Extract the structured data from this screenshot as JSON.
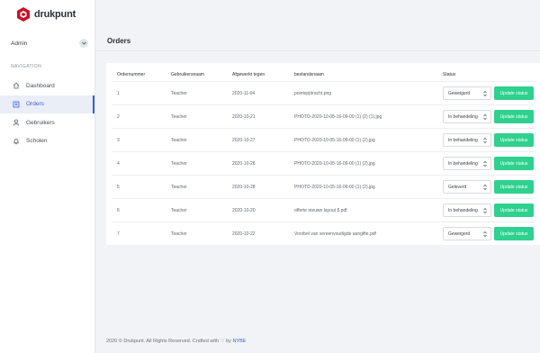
{
  "brand": {
    "name": "drukpunt",
    "color": "#c8102e"
  },
  "user": {
    "name": "Admin"
  },
  "nav": {
    "heading": "NAVIGATION",
    "items": [
      {
        "label": "Dashboard",
        "icon": "home-icon"
      },
      {
        "label": "Orders",
        "icon": "list-icon",
        "active": true
      },
      {
        "label": "Gebruikers",
        "icon": "user-icon"
      },
      {
        "label": "Scholen",
        "icon": "bell-icon"
      }
    ]
  },
  "page": {
    "title": "Orders"
  },
  "table": {
    "columns": [
      "Ordernummer",
      "Gebruikersnaam",
      "Afgewerkt tegen",
      "bestandsnaam",
      "Status"
    ],
    "rows": [
      {
        "id": "1",
        "user": "Teacher",
        "date": "2020-11-04",
        "file": "pointsp|dracht.png",
        "status": "Geweigerd"
      },
      {
        "id": "2",
        "user": "Teacher",
        "date": "2020-10-21",
        "file": "PHOTO-2020-10-05-16-09-00 (1) (2) (1).jpg",
        "status": "In behandeling"
      },
      {
        "id": "3",
        "user": "Teacher",
        "date": "2020-10-27",
        "file": "PHOTO-2020-10-05-16-09-00 (1) (2).jpg",
        "status": "In behandeling"
      },
      {
        "id": "4",
        "user": "Teacher",
        "date": "2020-10-28",
        "file": "PHOTO-2020-10-05-16-09-00 (1) (2).jpg",
        "status": "In behandeling"
      },
      {
        "id": "5",
        "user": "Teacher",
        "date": "2020-10-28",
        "file": "PHOTO-2020-10-05-16-09-00 (1) (2).jpg",
        "status": "Geleverd"
      },
      {
        "id": "6",
        "user": "Teacher",
        "date": "2020-10-20",
        "file": "offerte nieuwe layout 8.pdf",
        "status": "In behandeling"
      },
      {
        "id": "7",
        "user": "Teacher",
        "date": "2020-10-22",
        "file": "Voorbel van vereenvoudigde aangifte.pdf",
        "status": "Geweigerd"
      }
    ],
    "update_label": "Update status",
    "update_color": "#2ed18e"
  },
  "footer": {
    "text": "2020 © Drukpunt. All Rights Reserved. Crafted with",
    "heart": "♡",
    "by": "by",
    "brand": "NYBE"
  }
}
